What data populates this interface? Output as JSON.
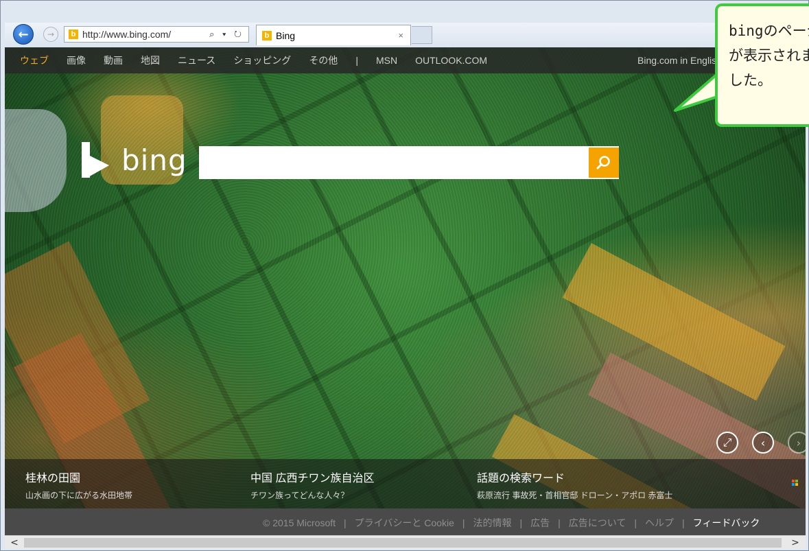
{
  "browser": {
    "address_url": "http://www.bing.com/",
    "address_icons": "⌕ ▾ ↻",
    "tab_title": "Bing",
    "tab_favicon": "b",
    "tab_close": "×"
  },
  "topnav": {
    "items": [
      "ウェブ",
      "画像",
      "動画",
      "地図",
      "ニュース",
      "ショッピング",
      "その他"
    ],
    "separator": "|",
    "extra": [
      "MSN",
      "OUTLOOK.COM"
    ],
    "right": "Bing.com in English"
  },
  "logo": {
    "text": "bing"
  },
  "search": {
    "value": "",
    "placeholder": ""
  },
  "info": {
    "left": {
      "title": "桂林の田園",
      "subtitle": "山水画の下に広がる水田地帯"
    },
    "middle": {
      "title": "中国 広西チワン族自治区",
      "subtitle": "チワン族ってどんな人々？"
    },
    "right": {
      "title": "話題の検索ワード",
      "subtitle": "萩原流行 事故死・首相官邸 ドローン・アポロ 赤富士"
    }
  },
  "footer": {
    "copyright": "© 2015 Microsoft",
    "links": [
      "プライバシーと Cookie",
      "法的情報",
      "広告",
      "広告について",
      "ヘルプ"
    ],
    "last": "フィードバック"
  },
  "callout": {
    "lines": [
      "bingのページ",
      "が表示されま",
      "した。"
    ]
  },
  "colors": {
    "accent": "#f5a300",
    "callout_border": "#3fcb3f",
    "callout_bg": "#fffde6",
    "active_nav": "#f5a623"
  },
  "icons": {
    "back": "back-arrow-icon",
    "forward": "forward-arrow-icon",
    "search": "search-icon",
    "fullscreen": "expand-icon",
    "prev": "chevron-left-icon",
    "next": "chevron-right-icon"
  }
}
